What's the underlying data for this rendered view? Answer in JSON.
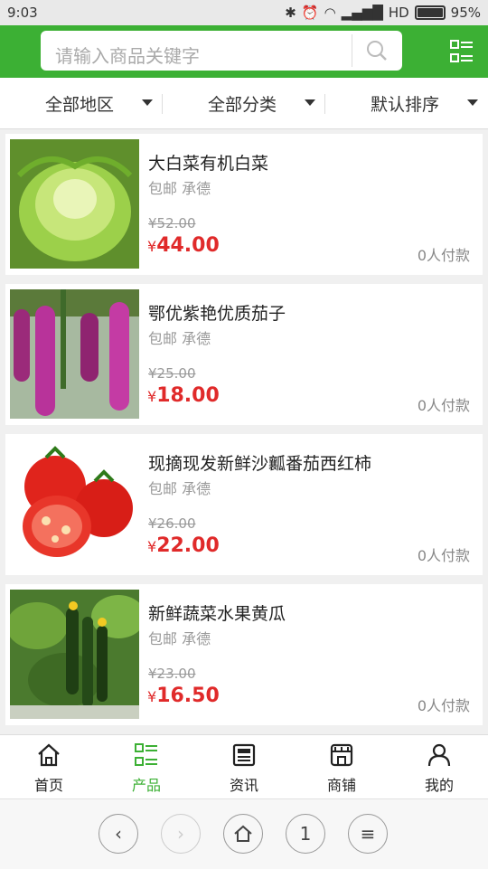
{
  "status": {
    "time": "9:03",
    "network": "HD",
    "battery": "95%",
    "battery_level": 0.95
  },
  "search": {
    "placeholder": "请输入商品关键字"
  },
  "filters": [
    {
      "label": "全部地区"
    },
    {
      "label": "全部分类"
    },
    {
      "label": "默认排序"
    }
  ],
  "products": [
    {
      "name": "大白菜有机白菜",
      "tags": "包邮 承德",
      "old_price": "¥52.00",
      "currency": "¥",
      "price": "44.00",
      "sold": "0人付款",
      "image": "cabbage"
    },
    {
      "name": "鄂优紫艳优质茄子",
      "tags": "包邮 承德",
      "old_price": "¥25.00",
      "currency": "¥",
      "price": "18.00",
      "sold": "0人付款",
      "image": "eggplant"
    },
    {
      "name": "现摘现发新鲜沙瓤番茄西红柿",
      "tags": "包邮 承德",
      "old_price": "¥26.00",
      "currency": "¥",
      "price": "22.00",
      "sold": "0人付款",
      "image": "tomato"
    },
    {
      "name": "新鲜蔬菜水果黄瓜",
      "tags": "包邮 承德",
      "old_price": "¥23.00",
      "currency": "¥",
      "price": "16.50",
      "sold": "0人付款",
      "image": "cucumber"
    }
  ],
  "tabs": [
    {
      "label": "首页",
      "icon": "home-icon"
    },
    {
      "label": "产品",
      "icon": "list-icon",
      "active": true
    },
    {
      "label": "资讯",
      "icon": "news-icon"
    },
    {
      "label": "商铺",
      "icon": "shop-icon"
    },
    {
      "label": "我的",
      "icon": "user-icon"
    }
  ],
  "browser_nav": {
    "page_count": "1"
  },
  "colors": {
    "brand": "#3cb034",
    "price": "#e02a2a"
  }
}
